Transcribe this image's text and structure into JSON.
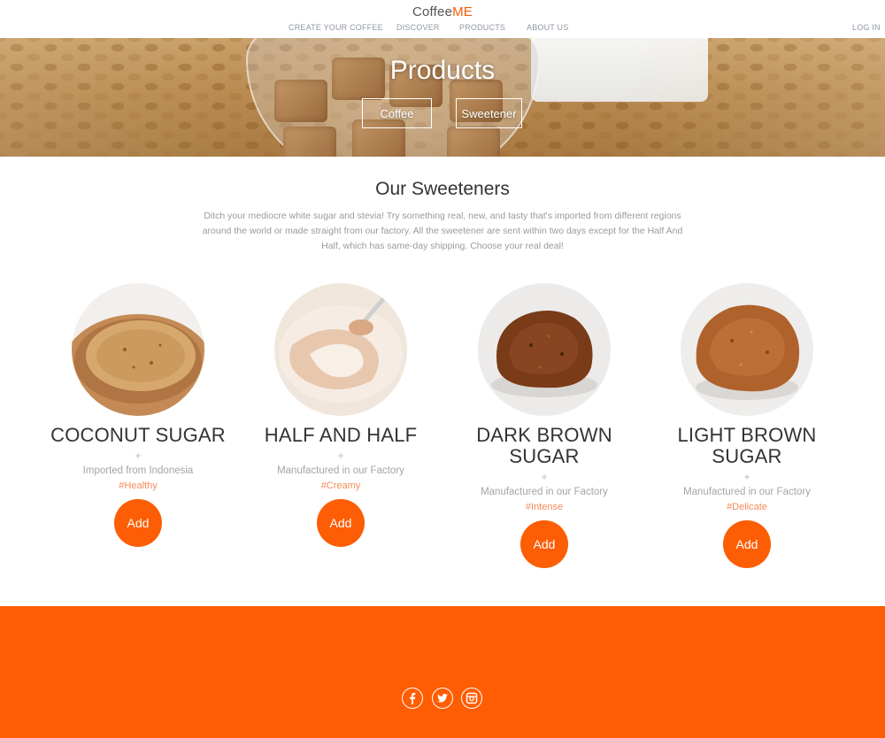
{
  "brand": {
    "name_part1": "Coffee",
    "name_part2": "ME"
  },
  "nav": {
    "items": [
      "CREATE YOUR COFFEE",
      "DISCOVER",
      "PRODUCTS",
      "ABOUT US"
    ],
    "login": "LOG IN"
  },
  "hero": {
    "title": "Products",
    "buttons": [
      "Coffee",
      "Sweetener"
    ]
  },
  "section": {
    "title": "Our Sweeteners",
    "description": "Ditch your mediocre white sugar and stevia! Try something real, new, and tasty that's imported from different regions around the world or made straight from our factory. All the sweetener are sent within two days except for the Half And Half, which has same-day shipping. Choose your real deal!"
  },
  "products": [
    {
      "name": "COCONUT SUGAR",
      "plus": "+",
      "origin": "Imported from Indonesia",
      "tag": "#Healthy",
      "add": "Add",
      "image": "coconut-sugar-bowl"
    },
    {
      "name": "HALF AND HALF",
      "plus": "+",
      "origin": "Manufactured in our Factory",
      "tag": "#Creamy",
      "add": "Add",
      "image": "half-and-half-spoon"
    },
    {
      "name": "DARK BROWN SUGAR",
      "plus": "+",
      "origin": "Manufactured in our Factory",
      "tag": "#Intense",
      "add": "Add",
      "image": "dark-brown-sugar-mound"
    },
    {
      "name": "LIGHT BROWN SUGAR",
      "plus": "+",
      "origin": "Manufactured in our Factory",
      "tag": "#Delicate",
      "add": "Add",
      "image": "light-brown-sugar-mound"
    }
  ],
  "footer": {
    "social_icons": [
      "facebook-icon",
      "twitter-icon",
      "instagram-icon"
    ]
  },
  "colors": {
    "accent": "#fe5d03",
    "tag": "#f38a58",
    "nav": "#8f96a3"
  }
}
